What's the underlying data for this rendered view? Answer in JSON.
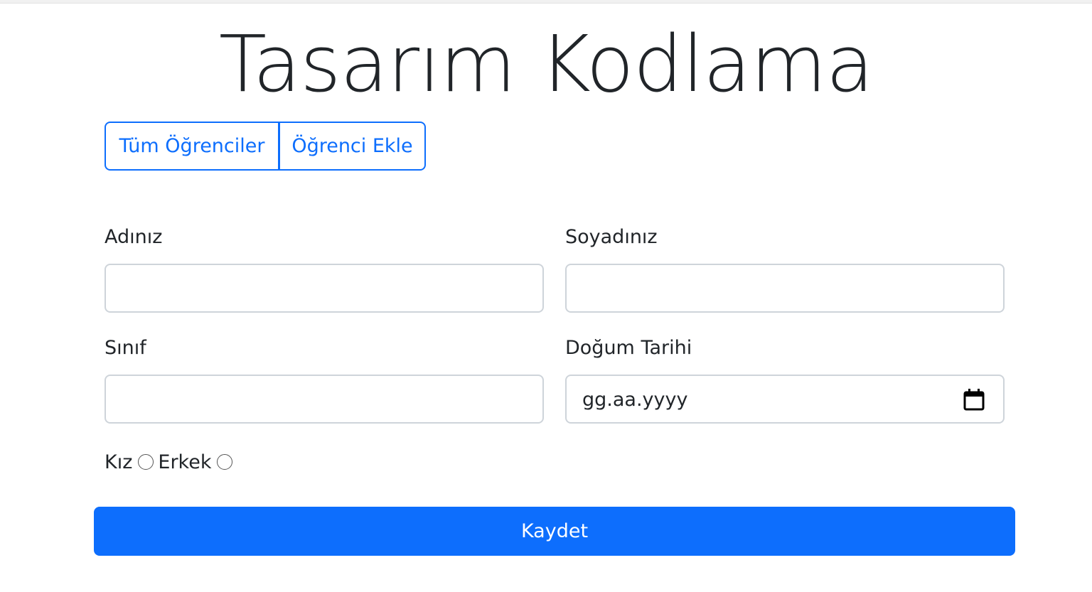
{
  "page": {
    "title": "Tasarım Kodlama"
  },
  "nav": {
    "all_students": "Tüm Öğrenciler",
    "add_student": "Öğrenci Ekle"
  },
  "form": {
    "first_name_label": "Adınız",
    "first_name_value": "",
    "last_name_label": "Soyadınız",
    "last_name_value": "",
    "class_label": "Sınıf",
    "class_value": "",
    "birth_date_label": "Doğum Tarihi",
    "birth_date_placeholder": "gg.aa.yyyy",
    "gender_options": [
      "Kız",
      "Erkek"
    ],
    "submit_label": "Kaydet"
  },
  "colors": {
    "primary": "#0d6efd",
    "border": "#ced4da",
    "text": "#212529"
  },
  "icons": {
    "date_picker": "calendar-icon"
  }
}
